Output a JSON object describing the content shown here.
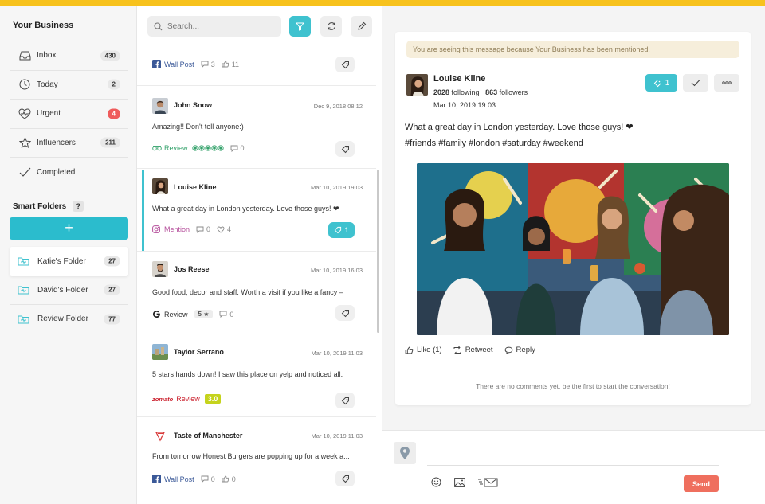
{
  "brand": {
    "accent": "#3fc2cf",
    "topbar": "#f7c21d",
    "send": "#ef6f5e"
  },
  "sidebar": {
    "title": "Your Business",
    "items": [
      {
        "label": "Inbox",
        "count": "430",
        "icon": "inbox-icon"
      },
      {
        "label": "Today",
        "count": "2",
        "icon": "clock-icon"
      },
      {
        "label": "Urgent",
        "count": "4",
        "icon": "heartbeat-icon"
      },
      {
        "label": "Influencers",
        "count": "211",
        "icon": "star-icon"
      },
      {
        "label": "Completed",
        "count": "",
        "icon": "check-icon"
      }
    ],
    "smart_folders_title": "Smart Folders",
    "help": "?",
    "add_label": "+",
    "folders": [
      {
        "label": "Katie's Folder",
        "count": "27"
      },
      {
        "label": "David's Folder",
        "count": "27"
      },
      {
        "label": "Review Folder",
        "count": "77"
      }
    ]
  },
  "list": {
    "search_placeholder": "Search...",
    "posts": [
      {
        "source": "Wall Post",
        "comments": "3",
        "likes": "11"
      },
      {
        "name": "John Snow",
        "date": "Dec 9, 2018 08:12",
        "body": "Amazing!! Don't tell anyone:)",
        "source": "Review",
        "comments": "0"
      },
      {
        "name": "Louise Kline",
        "date": "Mar 10, 2019 19:03",
        "body": "What a great day in London yesterday. Love those guys! ❤",
        "source": "Mention",
        "comments": "0",
        "likes": "4",
        "tags": "1"
      },
      {
        "name": "Jos Reese",
        "date": "Mar 10, 2019 16:03",
        "body": "Good food, decor and staff. Worth a visit if you like a fancy –",
        "source": "Review",
        "stars": "5 ★",
        "comments": "0"
      },
      {
        "name": "Taylor Serrano",
        "date": "Mar 10, 2019 11:03",
        "body": "5 stars hands down! I saw this place on yelp and noticed all.",
        "brand": "zomato",
        "source": "Review",
        "score": "3.0"
      },
      {
        "name": "Taste of Manchester",
        "date": "Mar 10, 2019 11:03",
        "body": "From tomorrow Honest Burgers are popping up for a week a...",
        "source": "Wall Post",
        "comments": "0",
        "likes": "0"
      }
    ]
  },
  "detail": {
    "notice": "You are seeing this message because Your Business has been mentioned.",
    "name": "Louise Kline",
    "following": "2028",
    "following_label": "following",
    "followers": "863",
    "followers_label": "followers",
    "date": "Mar 10, 2019 19:03",
    "tag_count": "1",
    "text": "What a great day in London yesterday. Love those guys! ❤",
    "hashtags": "#friends #family #london #saturday #weekend",
    "like_label": "Like (1)",
    "retweet_label": "Retweet",
    "reply_label": "Reply",
    "no_comments": "There are no comments yet, be the first to start the conversation!",
    "send_label": "Send"
  }
}
